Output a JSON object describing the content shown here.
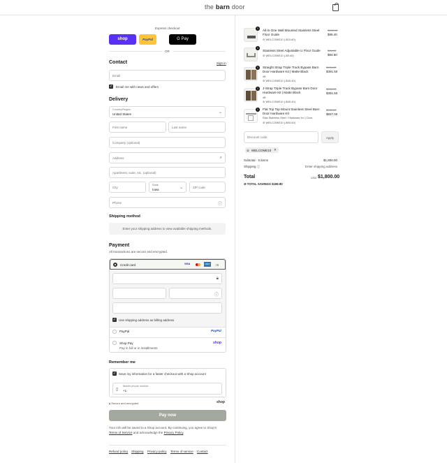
{
  "header": {
    "logo_pre": "the ",
    "logo_bold": "barn",
    "logo_post": " door"
  },
  "express": {
    "label": "Express checkout",
    "shop": "shop",
    "paypal": "PayPal",
    "gpay": "G Pay",
    "or": "OR"
  },
  "contact": {
    "title": "Contact",
    "signin": "Sign in",
    "email_placeholder": "Email",
    "news_label": "Email me with news and offers"
  },
  "delivery": {
    "title": "Delivery",
    "country_label": "Country/Region",
    "country_value": "United States",
    "first": "First name",
    "last": "Last name",
    "company": "Company (optional)",
    "address": "Address",
    "apt": "Apartment, suite, etc. (optional)",
    "city": "City",
    "state_label": "State",
    "state_value": "Iowa",
    "zip": "ZIP code",
    "phone": "Phone"
  },
  "shipping": {
    "title": "Shipping method",
    "note": "Enter your shipping address to view available shipping methods."
  },
  "payment": {
    "title": "Payment",
    "subtitle": "All transactions are secure and encrypted.",
    "card_label": "Credit card",
    "card_more": "+5",
    "card_brands": [
      "VISA",
      "MC",
      "AMEX"
    ],
    "billing_label": "Use shipping address as billing address",
    "paypal_label": "PayPal",
    "paypal_logo": "PayPal",
    "shoppay_label": "Shop Pay",
    "shoppay_sub": "Pay in full or in installments",
    "shoppay_logo": "shop"
  },
  "remember": {
    "title": "Remember me",
    "save_label": "Save my information for a faster checkout with a Shop account",
    "mobile_label": "Mobile phone number",
    "mobile_value": "+1",
    "secure": "Secure and encrypted",
    "shop_logo": "shop"
  },
  "paynow": "Pay now",
  "legal": {
    "text1": "Your info will be saved to a Shop account. By continuing, you agree to Shop's",
    "tos": "Terms of Service",
    "and": " and acknowledge the ",
    "privacy": "Privacy Policy",
    "end": "."
  },
  "footer": [
    "Refund policy",
    "Shipping",
    "Privacy policy",
    "Terms of service",
    "Contact"
  ],
  "items": [
    {
      "qty": "1",
      "name": "All-in-One Wall Mounted Stainless Steel Floor Guide",
      "code": "WELCOME10 (-$10.60)",
      "was": "$106.00",
      "price": "$95.40",
      "variant": ""
    },
    {
      "qty": "1",
      "name": "Stainless Steel Adjustable U Floor Guide",
      "code": "WELCOME10 (-$9.40)",
      "was": "$94.00",
      "price": "$84.60",
      "variant": ""
    },
    {
      "qty": "1",
      "name": "Straight Strap Triple Track Bypass Barn Door Hardware Kit | Matte Black",
      "code": "WELCOME10 (-$43.40)",
      "was": "$434.00",
      "price": "$391.50",
      "variant": "4ft"
    },
    {
      "qty": "1",
      "name": "J-Strap Triple Track Bypass Barn Door Hardware Kit | Matte Black",
      "code": "WELCOME10 (-$43.40)",
      "was": "$434.00",
      "price": "$391.50",
      "variant": "4ft"
    },
    {
      "qty": "1",
      "name": "Flat Top Top Mount Stainless Steel Barn Door Hardware Kit",
      "code": "WELCOME10 (-$93.00)",
      "was": "$930.00",
      "price": "$837.00",
      "variant": "Raw Stainless Steel / Hardware for 1 Door"
    }
  ],
  "discount": {
    "placeholder": "Discount code",
    "apply": "Apply",
    "tag": "WELCOME10"
  },
  "summary": {
    "subtotal_label": "Subtotal · 5 items",
    "subtotal": "$1,800.00",
    "shipping_label": "Shipping",
    "shipping_value": "Enter shipping address",
    "total_label": "Total",
    "currency": "USD",
    "total": "$1,800.00",
    "savings_label": "TOTAL SAVINGS",
    "savings": "$199.90"
  }
}
